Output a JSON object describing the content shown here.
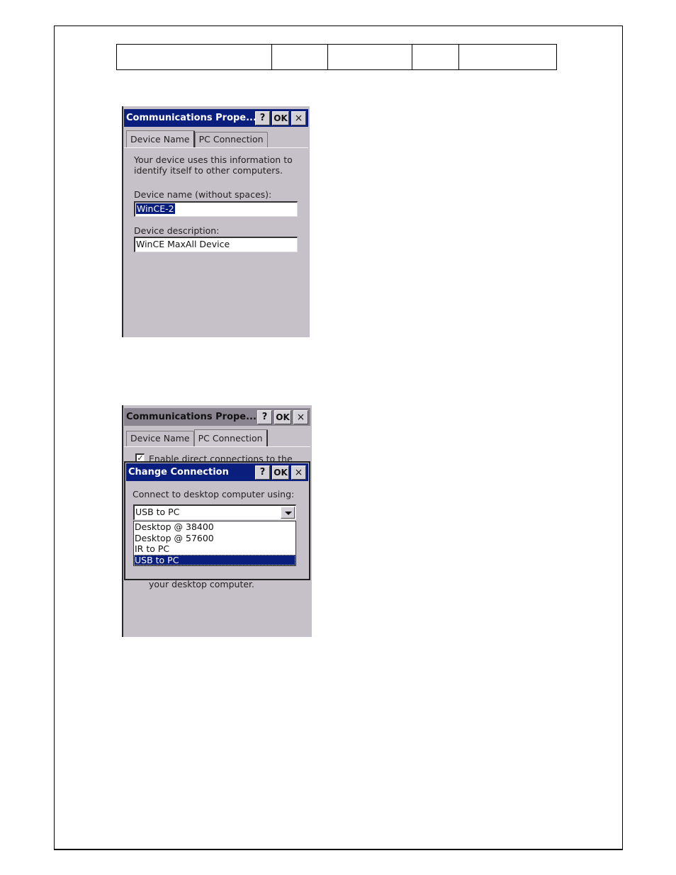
{
  "document": {
    "header_table": {
      "cells": [
        "",
        "",
        "",
        "",
        ""
      ]
    }
  },
  "dialog1": {
    "title": "Communications Prope...",
    "buttons": {
      "help": "?",
      "ok": "OK",
      "close": "×"
    },
    "tabs": [
      {
        "label": "Device Name",
        "active": true
      },
      {
        "label": "PC Connection",
        "active": false
      }
    ],
    "intro_line1": "Your device uses this information to",
    "intro_line2": "identify itself to other computers.",
    "device_name_label": "Device name (without spaces):",
    "device_name_value": "WinCE-2",
    "device_description_label": "Device description:",
    "device_description_value": "WinCE MaxAll Device"
  },
  "dialog2": {
    "title": "Communications Prope...",
    "buttons": {
      "help": "?",
      "ok": "OK",
      "close": "×"
    },
    "tabs": [
      {
        "label": "Device Name",
        "active": false
      },
      {
        "label": "PC Connection",
        "active": true
      }
    ],
    "checkbox_label": "Enable direct connections to the",
    "checkbox_checked": true,
    "footer_text": "your desktop computer.",
    "change_connection": {
      "title": "Change Connection",
      "buttons": {
        "help": "?",
        "ok": "OK",
        "close": "×"
      },
      "prompt": "Connect to desktop computer using:",
      "selected_value": "USB to PC",
      "options": [
        {
          "label": "Desktop @ 38400",
          "selected": false
        },
        {
          "label": "Desktop @ 57600",
          "selected": false
        },
        {
          "label": "IR to PC",
          "selected": false
        },
        {
          "label": "USB to PC",
          "selected": true
        }
      ]
    }
  },
  "colors": {
    "titlebar_active": "#0a1f7d",
    "dialog_background": "#c6c0c8",
    "selection": "#0a1f7d"
  }
}
